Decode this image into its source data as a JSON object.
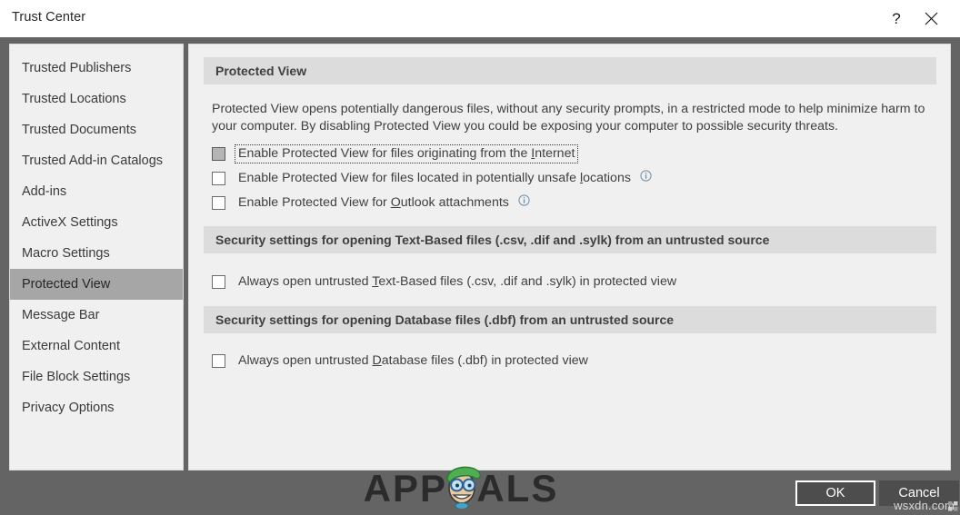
{
  "window": {
    "title": "Trust Center",
    "help_label": "?",
    "close_label": "✕"
  },
  "sidebar": {
    "items": [
      {
        "label": "Trusted Publishers",
        "selected": false
      },
      {
        "label": "Trusted Locations",
        "selected": false
      },
      {
        "label": "Trusted Documents",
        "selected": false
      },
      {
        "label": "Trusted Add-in Catalogs",
        "selected": false
      },
      {
        "label": "Add-ins",
        "selected": false
      },
      {
        "label": "ActiveX Settings",
        "selected": false
      },
      {
        "label": "Macro Settings",
        "selected": false
      },
      {
        "label": "Protected View",
        "selected": true
      },
      {
        "label": "Message Bar",
        "selected": false
      },
      {
        "label": "External Content",
        "selected": false
      },
      {
        "label": "File Block Settings",
        "selected": false
      },
      {
        "label": "Privacy Options",
        "selected": false
      }
    ]
  },
  "content": {
    "section1": {
      "header": "Protected View",
      "description": "Protected View opens potentially dangerous files, without any security prompts, in a restricted mode to help minimize harm to your computer. By disabling Protected View you could be exposing your computer to possible security threats.",
      "checkboxes": [
        {
          "label_before": "Enable Protected View for files originating from the ",
          "accelerator": "I",
          "label_after": "nternet",
          "checked": false,
          "hovered": true,
          "focused": true,
          "info": false
        },
        {
          "label_before": "Enable Protected View for files located in potentially unsafe ",
          "accelerator": "l",
          "label_after": "ocations",
          "checked": false,
          "hovered": false,
          "focused": false,
          "info": true
        },
        {
          "label_before": "Enable Protected View for ",
          "accelerator": "O",
          "label_after": "utlook attachments",
          "checked": false,
          "hovered": false,
          "focused": false,
          "info": true
        }
      ]
    },
    "section2": {
      "header": "Security settings for opening Text-Based files (.csv, .dif and .sylk) from an untrusted source",
      "checkboxes": [
        {
          "label_before": "Always open untrusted ",
          "accelerator": "T",
          "label_after": "ext-Based files (.csv, .dif and .sylk) in protected view",
          "checked": false,
          "hovered": false,
          "focused": false,
          "info": false
        }
      ]
    },
    "section3": {
      "header": "Security settings for opening Database files (.dbf) from an untrusted source",
      "checkboxes": [
        {
          "label_before": "Always open untrusted ",
          "accelerator": "D",
          "label_after": "atabase files (.dbf) in protected view",
          "checked": false,
          "hovered": false,
          "focused": false,
          "info": false
        }
      ]
    }
  },
  "footer": {
    "ok_label": "OK",
    "cancel_label": "Cancel"
  },
  "watermarks": {
    "appuals": "APPUALS",
    "wsxdn": "wsxdn.com"
  },
  "colors": {
    "backdrop": "#646464",
    "panel": "#f0f0f0",
    "section_header": "#dcdcdc",
    "selected_item": "#a6a6a6",
    "button": "#4d4d4d",
    "text": "#3f3f3f",
    "info_icon": "#6f8fa8"
  }
}
